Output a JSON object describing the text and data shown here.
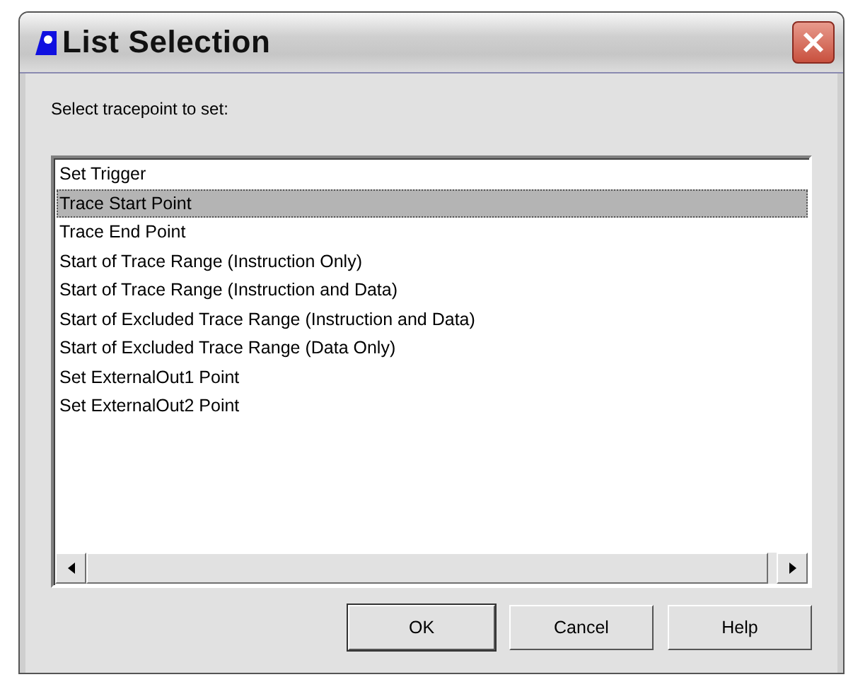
{
  "window": {
    "title": "List Selection"
  },
  "prompt": "Select tracepoint to set:",
  "list": {
    "items": [
      {
        "label": "Set Trigger",
        "selected": false
      },
      {
        "label": "Trace Start Point",
        "selected": true
      },
      {
        "label": "Trace End Point",
        "selected": false
      },
      {
        "label": "Start of Trace Range (Instruction Only)",
        "selected": false
      },
      {
        "label": "Start of Trace Range (Instruction and Data)",
        "selected": false
      },
      {
        "label": "Start of Excluded Trace Range (Instruction and Data)",
        "selected": false
      },
      {
        "label": "Start of Excluded Trace Range (Data Only)",
        "selected": false
      },
      {
        "label": "Set ExternalOut1 Point",
        "selected": false
      },
      {
        "label": "Set ExternalOut2 Point",
        "selected": false
      }
    ]
  },
  "buttons": [
    {
      "label": "OK",
      "default": true
    },
    {
      "label": "Cancel",
      "default": false
    },
    {
      "label": "Help",
      "default": false
    }
  ]
}
